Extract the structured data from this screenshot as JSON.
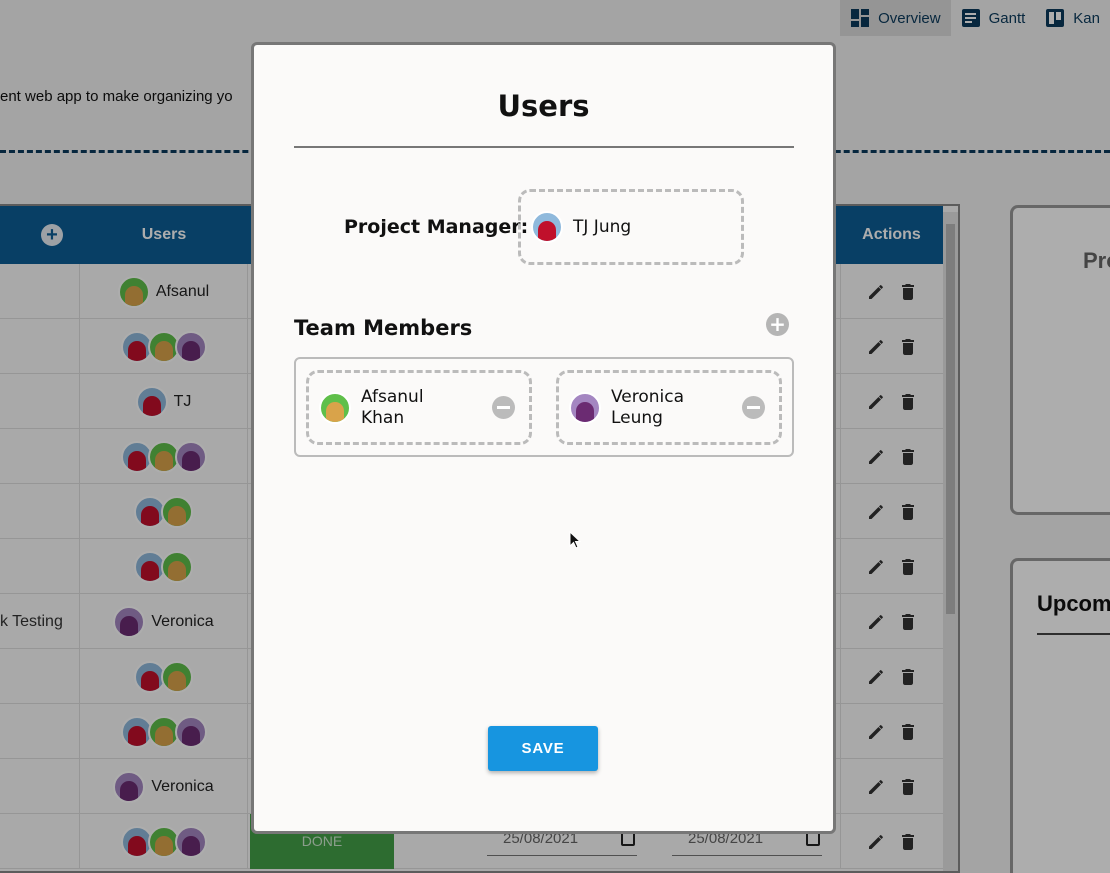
{
  "topnav": {
    "tabs": [
      {
        "label": "Overview",
        "icon": "dashboard-icon",
        "active": true
      },
      {
        "label": "Gantt",
        "icon": "gantt-icon",
        "active": false
      },
      {
        "label": "Kan",
        "icon": "kanban-icon",
        "active": false
      }
    ]
  },
  "page": {
    "tagline": "ent web app to make organizing yo"
  },
  "table": {
    "headers": {
      "users": "Users",
      "actions": "Actions"
    },
    "rows": [
      {
        "task": "",
        "users": [
          "af"
        ],
        "user_label": "Afsanul"
      },
      {
        "task": "",
        "users": [
          "tj",
          "af",
          "ve"
        ],
        "user_label": ""
      },
      {
        "task": "",
        "users": [
          "tj"
        ],
        "user_label": "TJ"
      },
      {
        "task": "",
        "users": [
          "tj",
          "af",
          "ve"
        ],
        "user_label": ""
      },
      {
        "task": "",
        "users": [
          "tj",
          "af"
        ],
        "user_label": ""
      },
      {
        "task": "",
        "users": [
          "tj",
          "af"
        ],
        "user_label": ""
      },
      {
        "task": "k Testing",
        "users": [
          "ve"
        ],
        "user_label": "Veronica"
      },
      {
        "task": "",
        "users": [
          "tj",
          "af"
        ],
        "user_label": ""
      },
      {
        "task": "",
        "users": [
          "tj",
          "af",
          "ve"
        ],
        "user_label": ""
      },
      {
        "task": "",
        "users": [
          "ve"
        ],
        "user_label": "Veronica"
      },
      {
        "task": "",
        "users": [
          "tj",
          "af",
          "ve"
        ],
        "user_label": "",
        "status": "DONE",
        "start_date": "25/08/2021",
        "end_date": "25/08/2021"
      }
    ]
  },
  "side": {
    "card1_title": "Pro",
    "card2_title": "Upcom"
  },
  "modal": {
    "title": "Users",
    "pm_label": "Project Manager:",
    "pm_name": "TJ Jung",
    "team_label": "Team Members",
    "members": [
      {
        "name": "Afsanul Khan",
        "avatar": "af"
      },
      {
        "name": "Veronica Leung",
        "avatar": "ve"
      }
    ],
    "save_label": "SAVE"
  },
  "colors": {
    "header_blue": "#0c5e96",
    "save_blue": "#1795e0",
    "done_green": "#43a047"
  }
}
